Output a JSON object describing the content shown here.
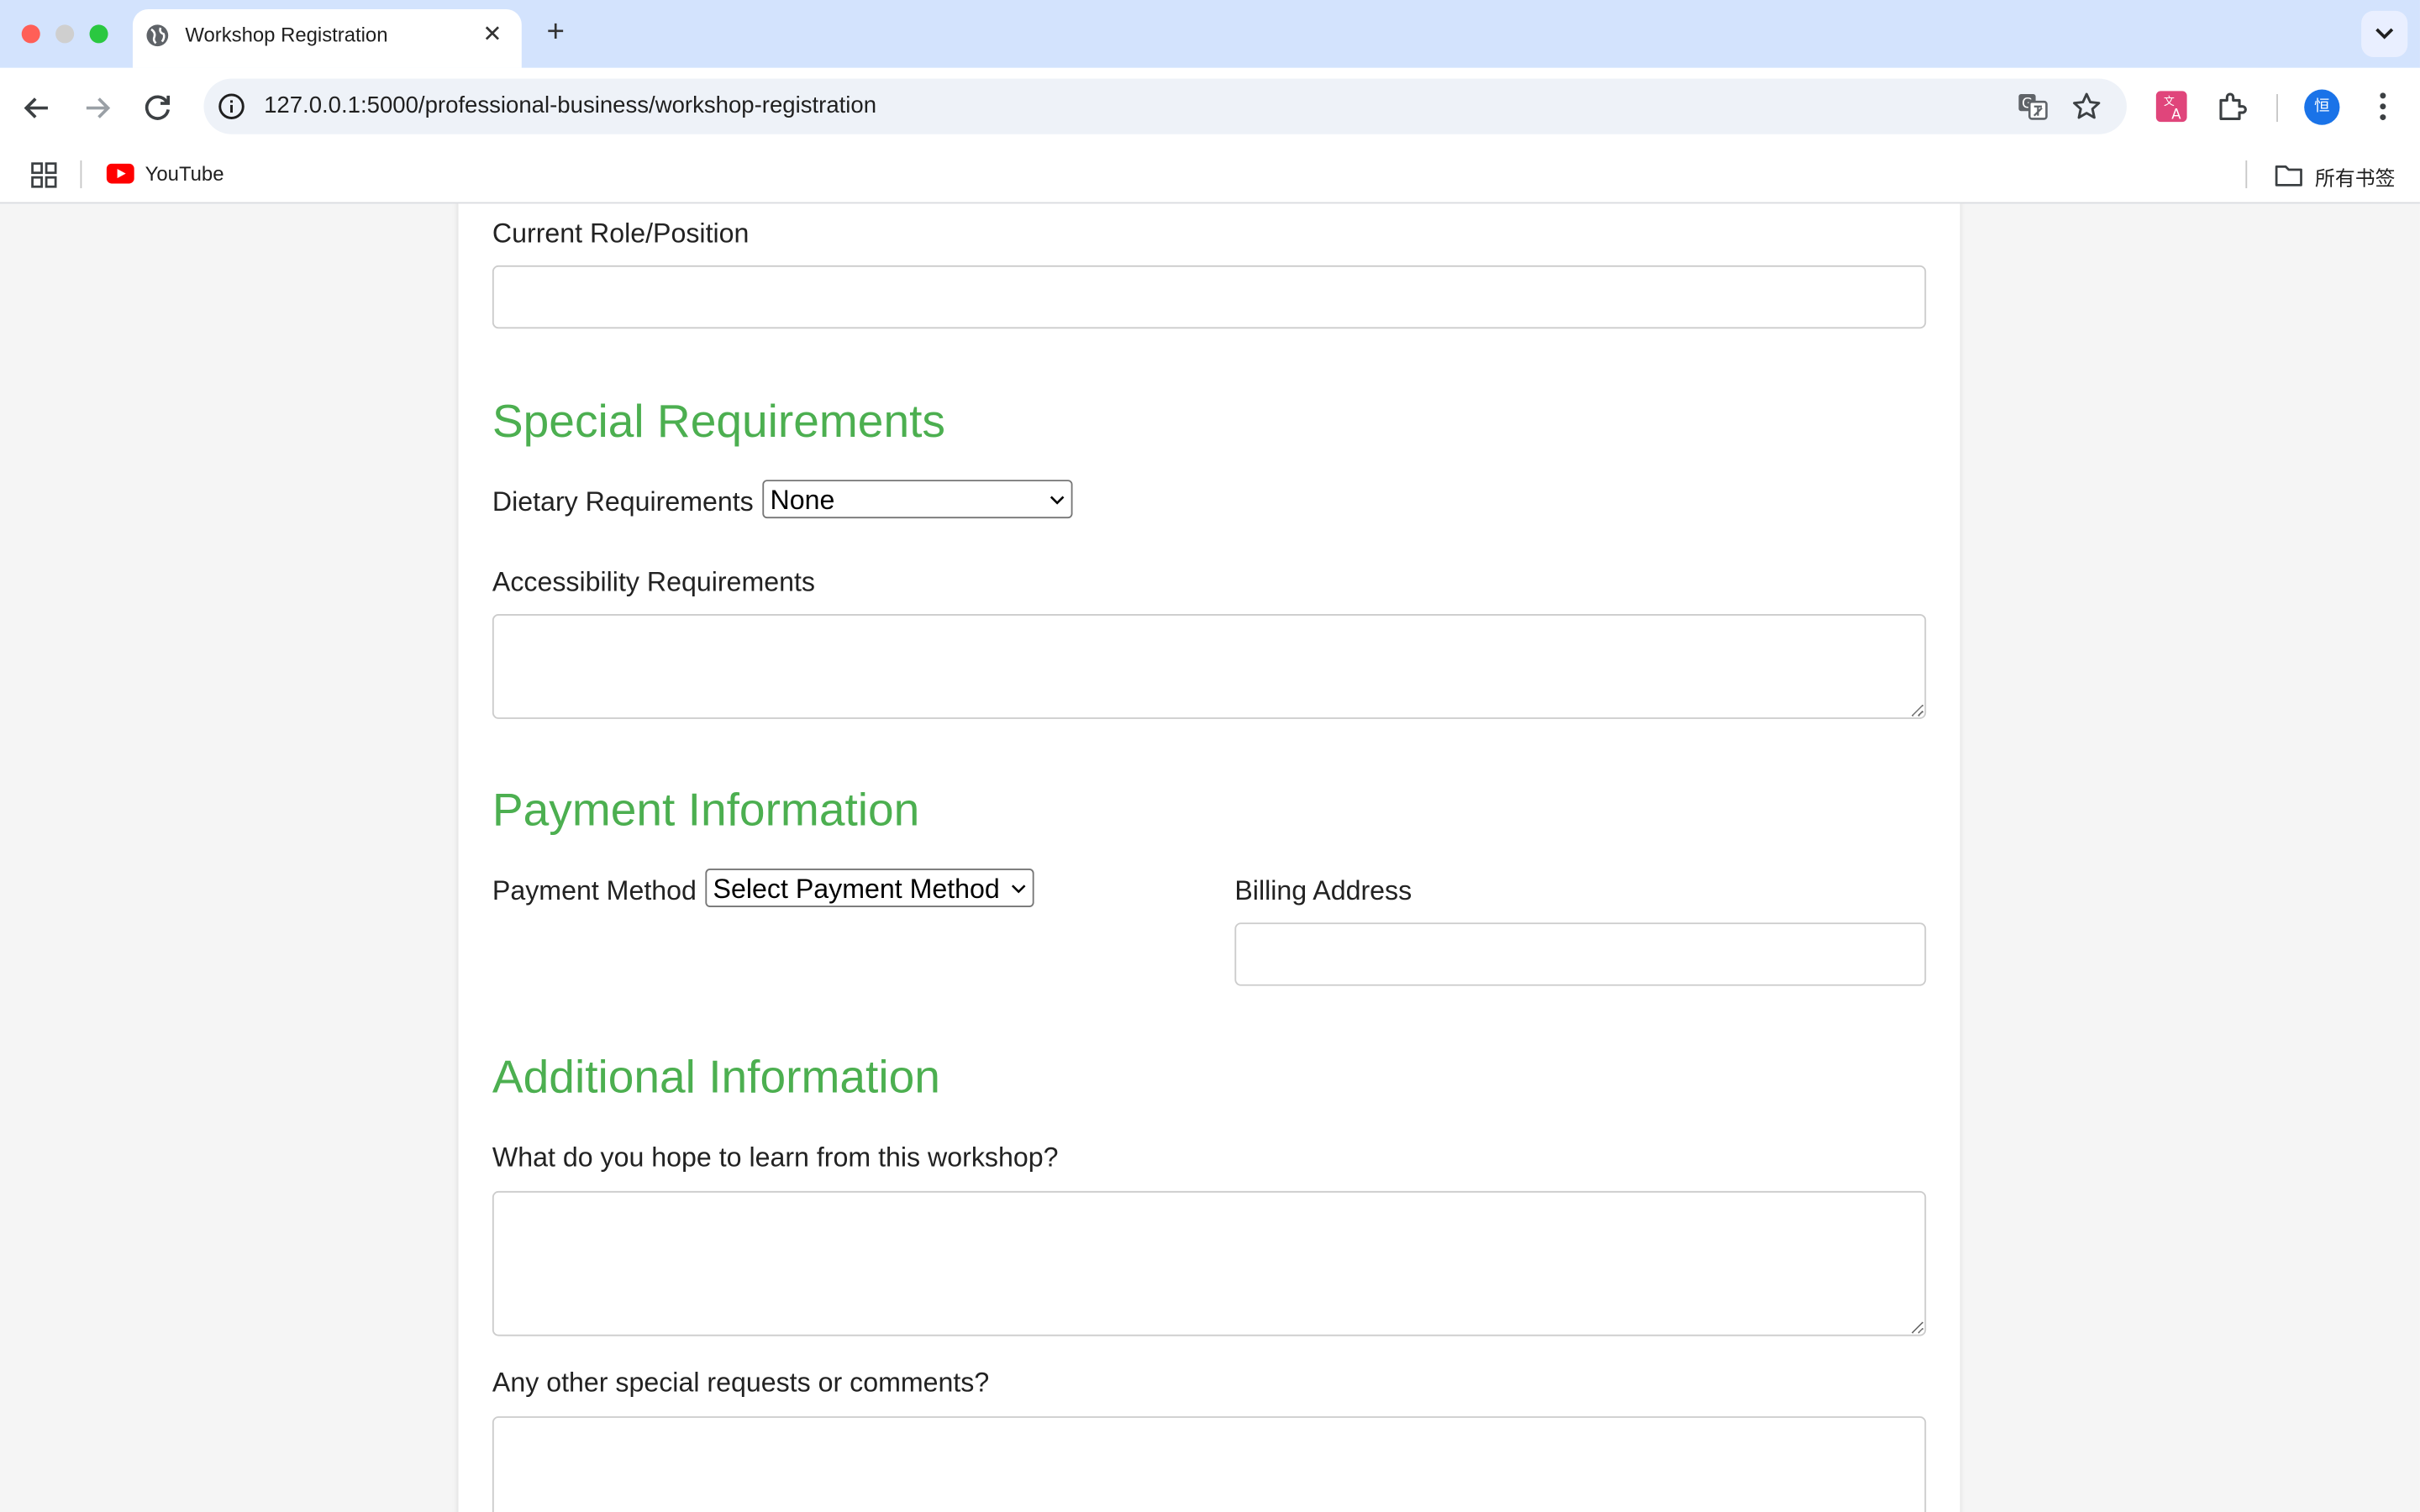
{
  "browser": {
    "tab_title": "Workshop Registration",
    "new_tab_symbol": "+",
    "close_symbol": "✕",
    "url": "127.0.0.1:5000/professional-business/workshop-registration",
    "bookmarks": {
      "youtube_label": "YouTube",
      "all_bookmarks_label": "所有书签"
    },
    "profile_initial": "恒"
  },
  "form": {
    "current_role": {
      "label": "Current Role/Position",
      "value": ""
    },
    "special_requirements": {
      "heading": "Special Requirements",
      "dietary_label": "Dietary Requirements",
      "dietary_selected": "None",
      "accessibility_label": "Accessibility Requirements",
      "accessibility_value": ""
    },
    "payment": {
      "heading": "Payment Information",
      "method_label": "Payment Method",
      "method_selected": "Select Payment Method",
      "billing_label": "Billing Address",
      "billing_value": ""
    },
    "additional": {
      "heading": "Additional Information",
      "learn_label": "What do you hope to learn from this workshop?",
      "learn_value": "",
      "comments_label": "Any other special requests or comments?",
      "comments_value": ""
    }
  },
  "colors": {
    "heading_green": "#4caf50",
    "tabstrip_bg": "#d3e3fd"
  }
}
